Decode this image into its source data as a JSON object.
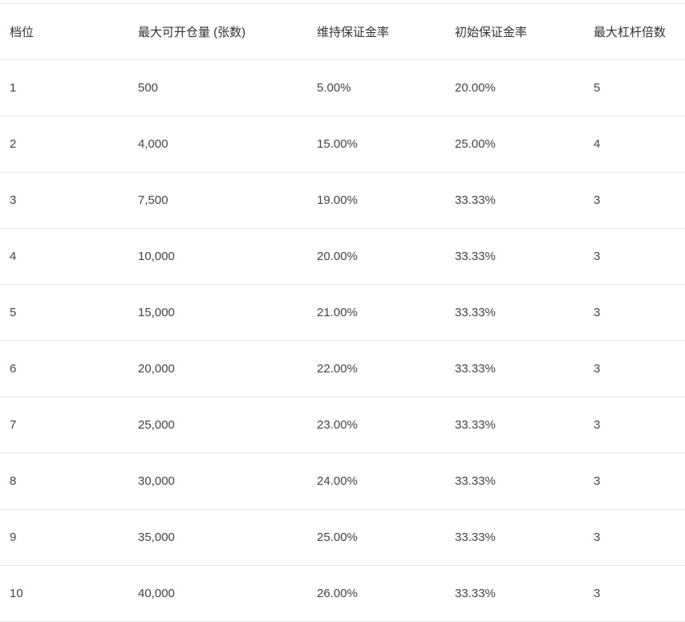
{
  "table": {
    "headers": [
      "档位",
      "最大可开仓量 (张数)",
      "维持保证金率",
      "初始保证金率",
      "最大杠杆倍数"
    ],
    "rows": [
      [
        "1",
        "500",
        "5.00%",
        "20.00%",
        "5"
      ],
      [
        "2",
        "4,000",
        "15.00%",
        "25.00%",
        "4"
      ],
      [
        "3",
        "7,500",
        "19.00%",
        "33.33%",
        "3"
      ],
      [
        "4",
        "10,000",
        "20.00%",
        "33.33%",
        "3"
      ],
      [
        "5",
        "15,000",
        "21.00%",
        "33.33%",
        "3"
      ],
      [
        "6",
        "20,000",
        "22.00%",
        "33.33%",
        "3"
      ],
      [
        "7",
        "25,000",
        "23.00%",
        "33.33%",
        "3"
      ],
      [
        "8",
        "30,000",
        "24.00%",
        "33.33%",
        "3"
      ],
      [
        "9",
        "35,000",
        "25.00%",
        "33.33%",
        "3"
      ],
      [
        "10",
        "40,000",
        "26.00%",
        "33.33%",
        "3"
      ]
    ]
  }
}
